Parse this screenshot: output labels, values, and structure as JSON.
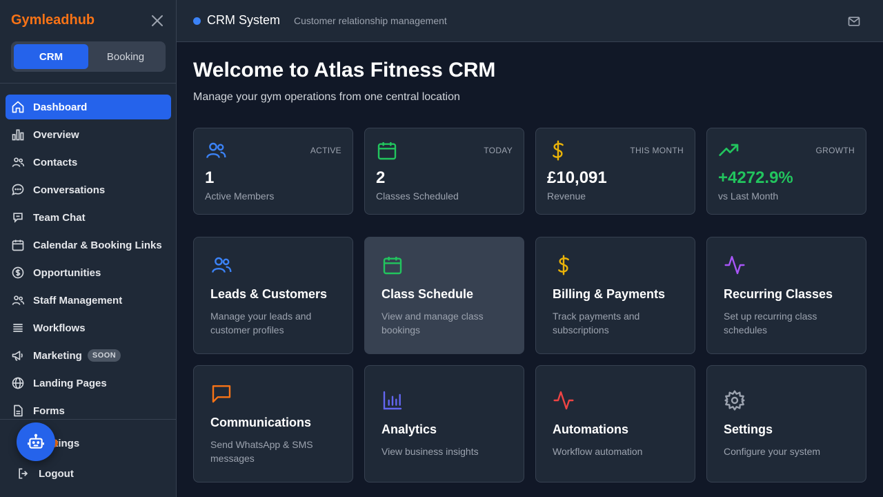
{
  "sidebar": {
    "brand": "Gymleadhub",
    "toggle": {
      "crm": "CRM",
      "booking": "Booking"
    },
    "items": [
      {
        "label": "Dashboard",
        "icon": "home-icon"
      },
      {
        "label": "Overview",
        "icon": "bar-chart-icon"
      },
      {
        "label": "Contacts",
        "icon": "users-icon"
      },
      {
        "label": "Conversations",
        "icon": "chat-bubble-icon"
      },
      {
        "label": "Team Chat",
        "icon": "message-square-icon"
      },
      {
        "label": "Calendar & Booking Links",
        "icon": "calendar-icon"
      },
      {
        "label": "Opportunities",
        "icon": "dollar-circle-icon"
      },
      {
        "label": "Staff Management",
        "icon": "users-icon"
      },
      {
        "label": "Workflows",
        "icon": "list-icon"
      },
      {
        "label": "Marketing",
        "icon": "megaphone-icon",
        "badge": "SOON"
      },
      {
        "label": "Landing Pages",
        "icon": "globe-icon"
      },
      {
        "label": "Forms",
        "icon": "file-icon"
      }
    ],
    "settings": "Settings",
    "logout": "Logout"
  },
  "header": {
    "title": "CRM System",
    "subtitle": "Customer relationship management"
  },
  "main": {
    "title": "Welcome to Atlas Fitness CRM",
    "subtitle": "Manage your gym operations from one central location",
    "stats": [
      {
        "tag": "ACTIVE",
        "value": "1",
        "label": "Active Members",
        "color": "#3b82f6",
        "icon": "users-icon"
      },
      {
        "tag": "TODAY",
        "value": "2",
        "label": "Classes Scheduled",
        "color": "#22c55e",
        "icon": "calendar-icon"
      },
      {
        "tag": "THIS MONTH",
        "value": "£10,091",
        "label": "Revenue",
        "color": "#eab308",
        "icon": "dollar-icon"
      },
      {
        "tag": "GROWTH",
        "value": "+4272.9%",
        "label": "vs Last Month",
        "color": "#22c55e",
        "icon": "trending-up-icon"
      }
    ],
    "features": [
      {
        "title": "Leads & Customers",
        "desc": "Manage your leads and customer profiles",
        "color": "#3b82f6",
        "icon": "users-icon"
      },
      {
        "title": "Class Schedule",
        "desc": "View and manage class bookings",
        "color": "#22c55e",
        "icon": "calendar-icon"
      },
      {
        "title": "Billing & Payments",
        "desc": "Track payments and subscriptions",
        "color": "#eab308",
        "icon": "dollar-icon"
      },
      {
        "title": "Recurring Classes",
        "desc": "Set up recurring class schedules",
        "color": "#a855f7",
        "icon": "activity-icon"
      },
      {
        "title": "Communications",
        "desc": "Send WhatsApp & SMS messages",
        "color": "#f97316",
        "icon": "message-square-icon"
      },
      {
        "title": "Analytics",
        "desc": "View business insights",
        "color": "#6366f1",
        "icon": "bar-chart-icon"
      },
      {
        "title": "Automations",
        "desc": "Workflow automation",
        "color": "#ef4444",
        "icon": "activity-icon"
      },
      {
        "title": "Settings",
        "desc": "Configure your system",
        "color": "#9ca3af",
        "icon": "gear-icon"
      }
    ]
  }
}
